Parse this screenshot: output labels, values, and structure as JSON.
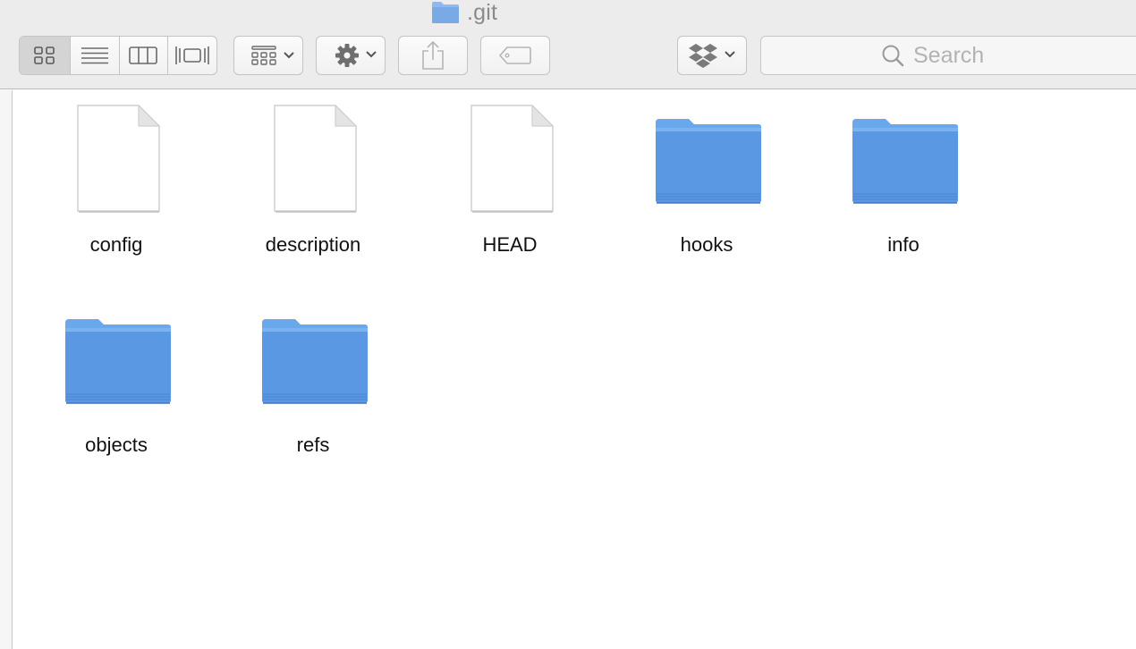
{
  "window": {
    "title": ".git"
  },
  "toolbar": {
    "view_modes": [
      "icon-view",
      "list-view",
      "column-view",
      "cover-flow-view"
    ],
    "active_view": "icon-view",
    "arrange_label": "arrange",
    "action_label": "action",
    "share_label": "share",
    "tags_label": "tags",
    "dropbox_label": "dropbox"
  },
  "search": {
    "placeholder": "Search",
    "value": ""
  },
  "items": [
    {
      "name": "config",
      "kind": "file"
    },
    {
      "name": "description",
      "kind": "file"
    },
    {
      "name": "HEAD",
      "kind": "file"
    },
    {
      "name": "hooks",
      "kind": "folder"
    },
    {
      "name": "info",
      "kind": "folder"
    },
    {
      "name": "objects",
      "kind": "folder"
    },
    {
      "name": "refs",
      "kind": "folder"
    }
  ],
  "colors": {
    "folder": "#5b9be6",
    "folder_tab": "#6aa8ee",
    "toolbar_bg": "#ececec"
  }
}
